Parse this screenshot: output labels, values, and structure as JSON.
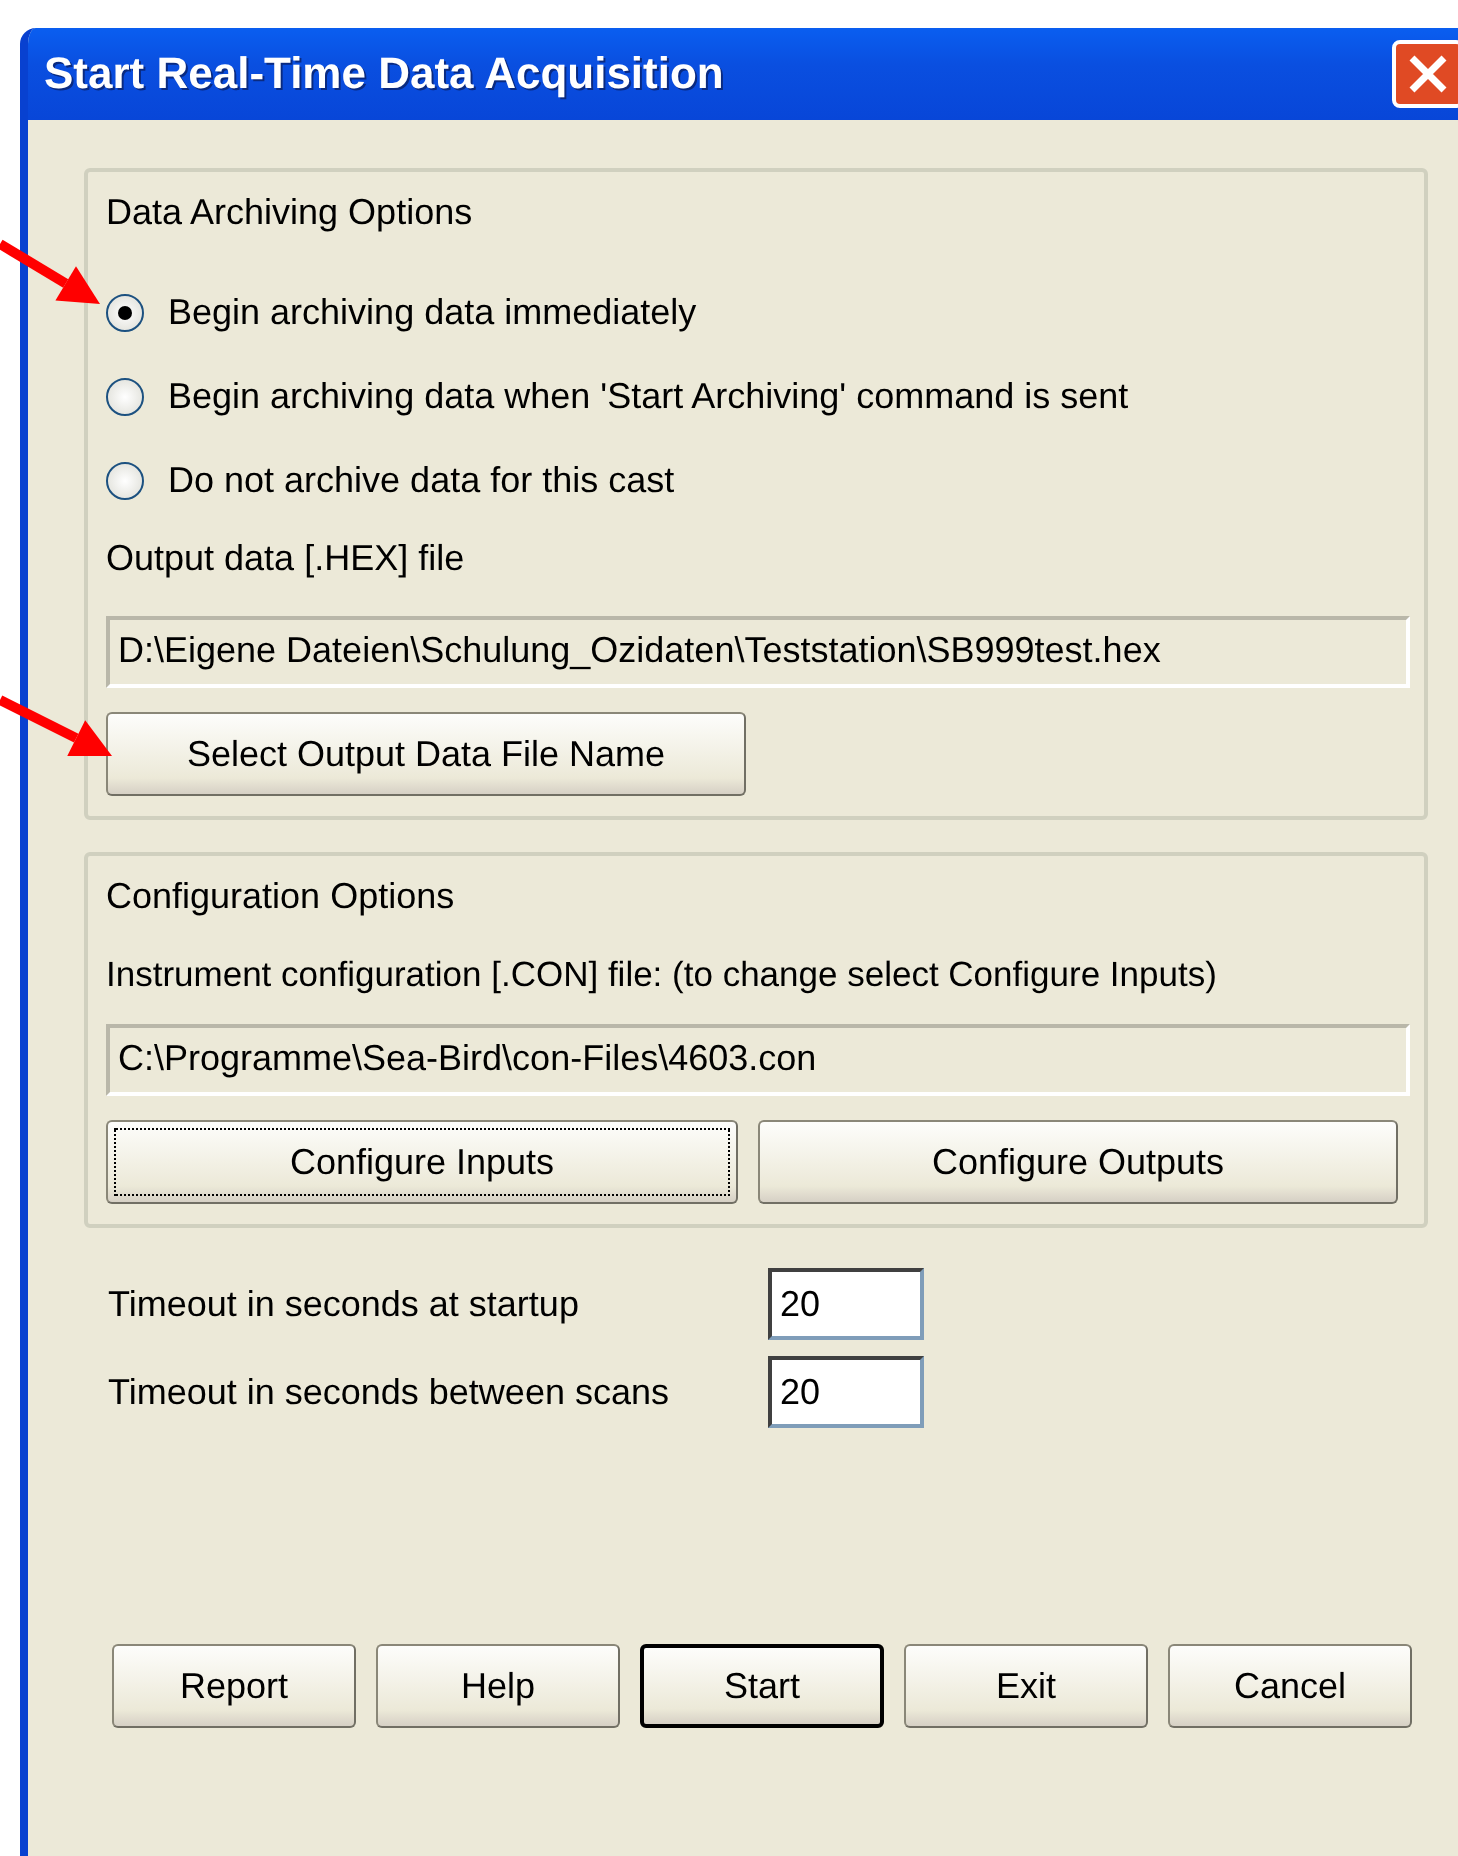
{
  "window": {
    "title": "Start Real-Time Data Acquisition"
  },
  "archiving": {
    "title": "Data Archiving Options",
    "options": [
      {
        "label": "Begin archiving data immediately",
        "selected": true
      },
      {
        "label": "Begin archiving data when 'Start Archiving' command is sent",
        "selected": false
      },
      {
        "label": "Do not archive data for this cast",
        "selected": false
      }
    ],
    "output_label": "Output data [.HEX] file",
    "output_path": "D:\\Eigene Dateien\\Schulung_Ozidaten\\Teststation\\SB999test.hex",
    "select_button": "Select Output Data File Name"
  },
  "configuration": {
    "title": "Configuration Options",
    "file_label": "Instrument configuration [.CON] file: (to change select Configure Inputs)",
    "file_path": "C:\\Programme\\Sea-Bird\\con-Files\\4603.con",
    "buttons": [
      {
        "label": "Configure Inputs",
        "focused": true
      },
      {
        "label": "Configure Outputs",
        "focused": false
      }
    ]
  },
  "timeouts": [
    {
      "label": "Timeout in seconds at startup",
      "value": "20"
    },
    {
      "label": "Timeout in seconds between scans",
      "value": "20"
    }
  ],
  "buttons": [
    {
      "label": "Report",
      "default": false
    },
    {
      "label": "Help",
      "default": false
    },
    {
      "label": "Start",
      "default": true
    },
    {
      "label": "Exit",
      "default": false
    },
    {
      "label": "Cancel",
      "default": false
    }
  ],
  "annotations": [
    {
      "kind": "arrow"
    },
    {
      "kind": "arrow"
    }
  ]
}
